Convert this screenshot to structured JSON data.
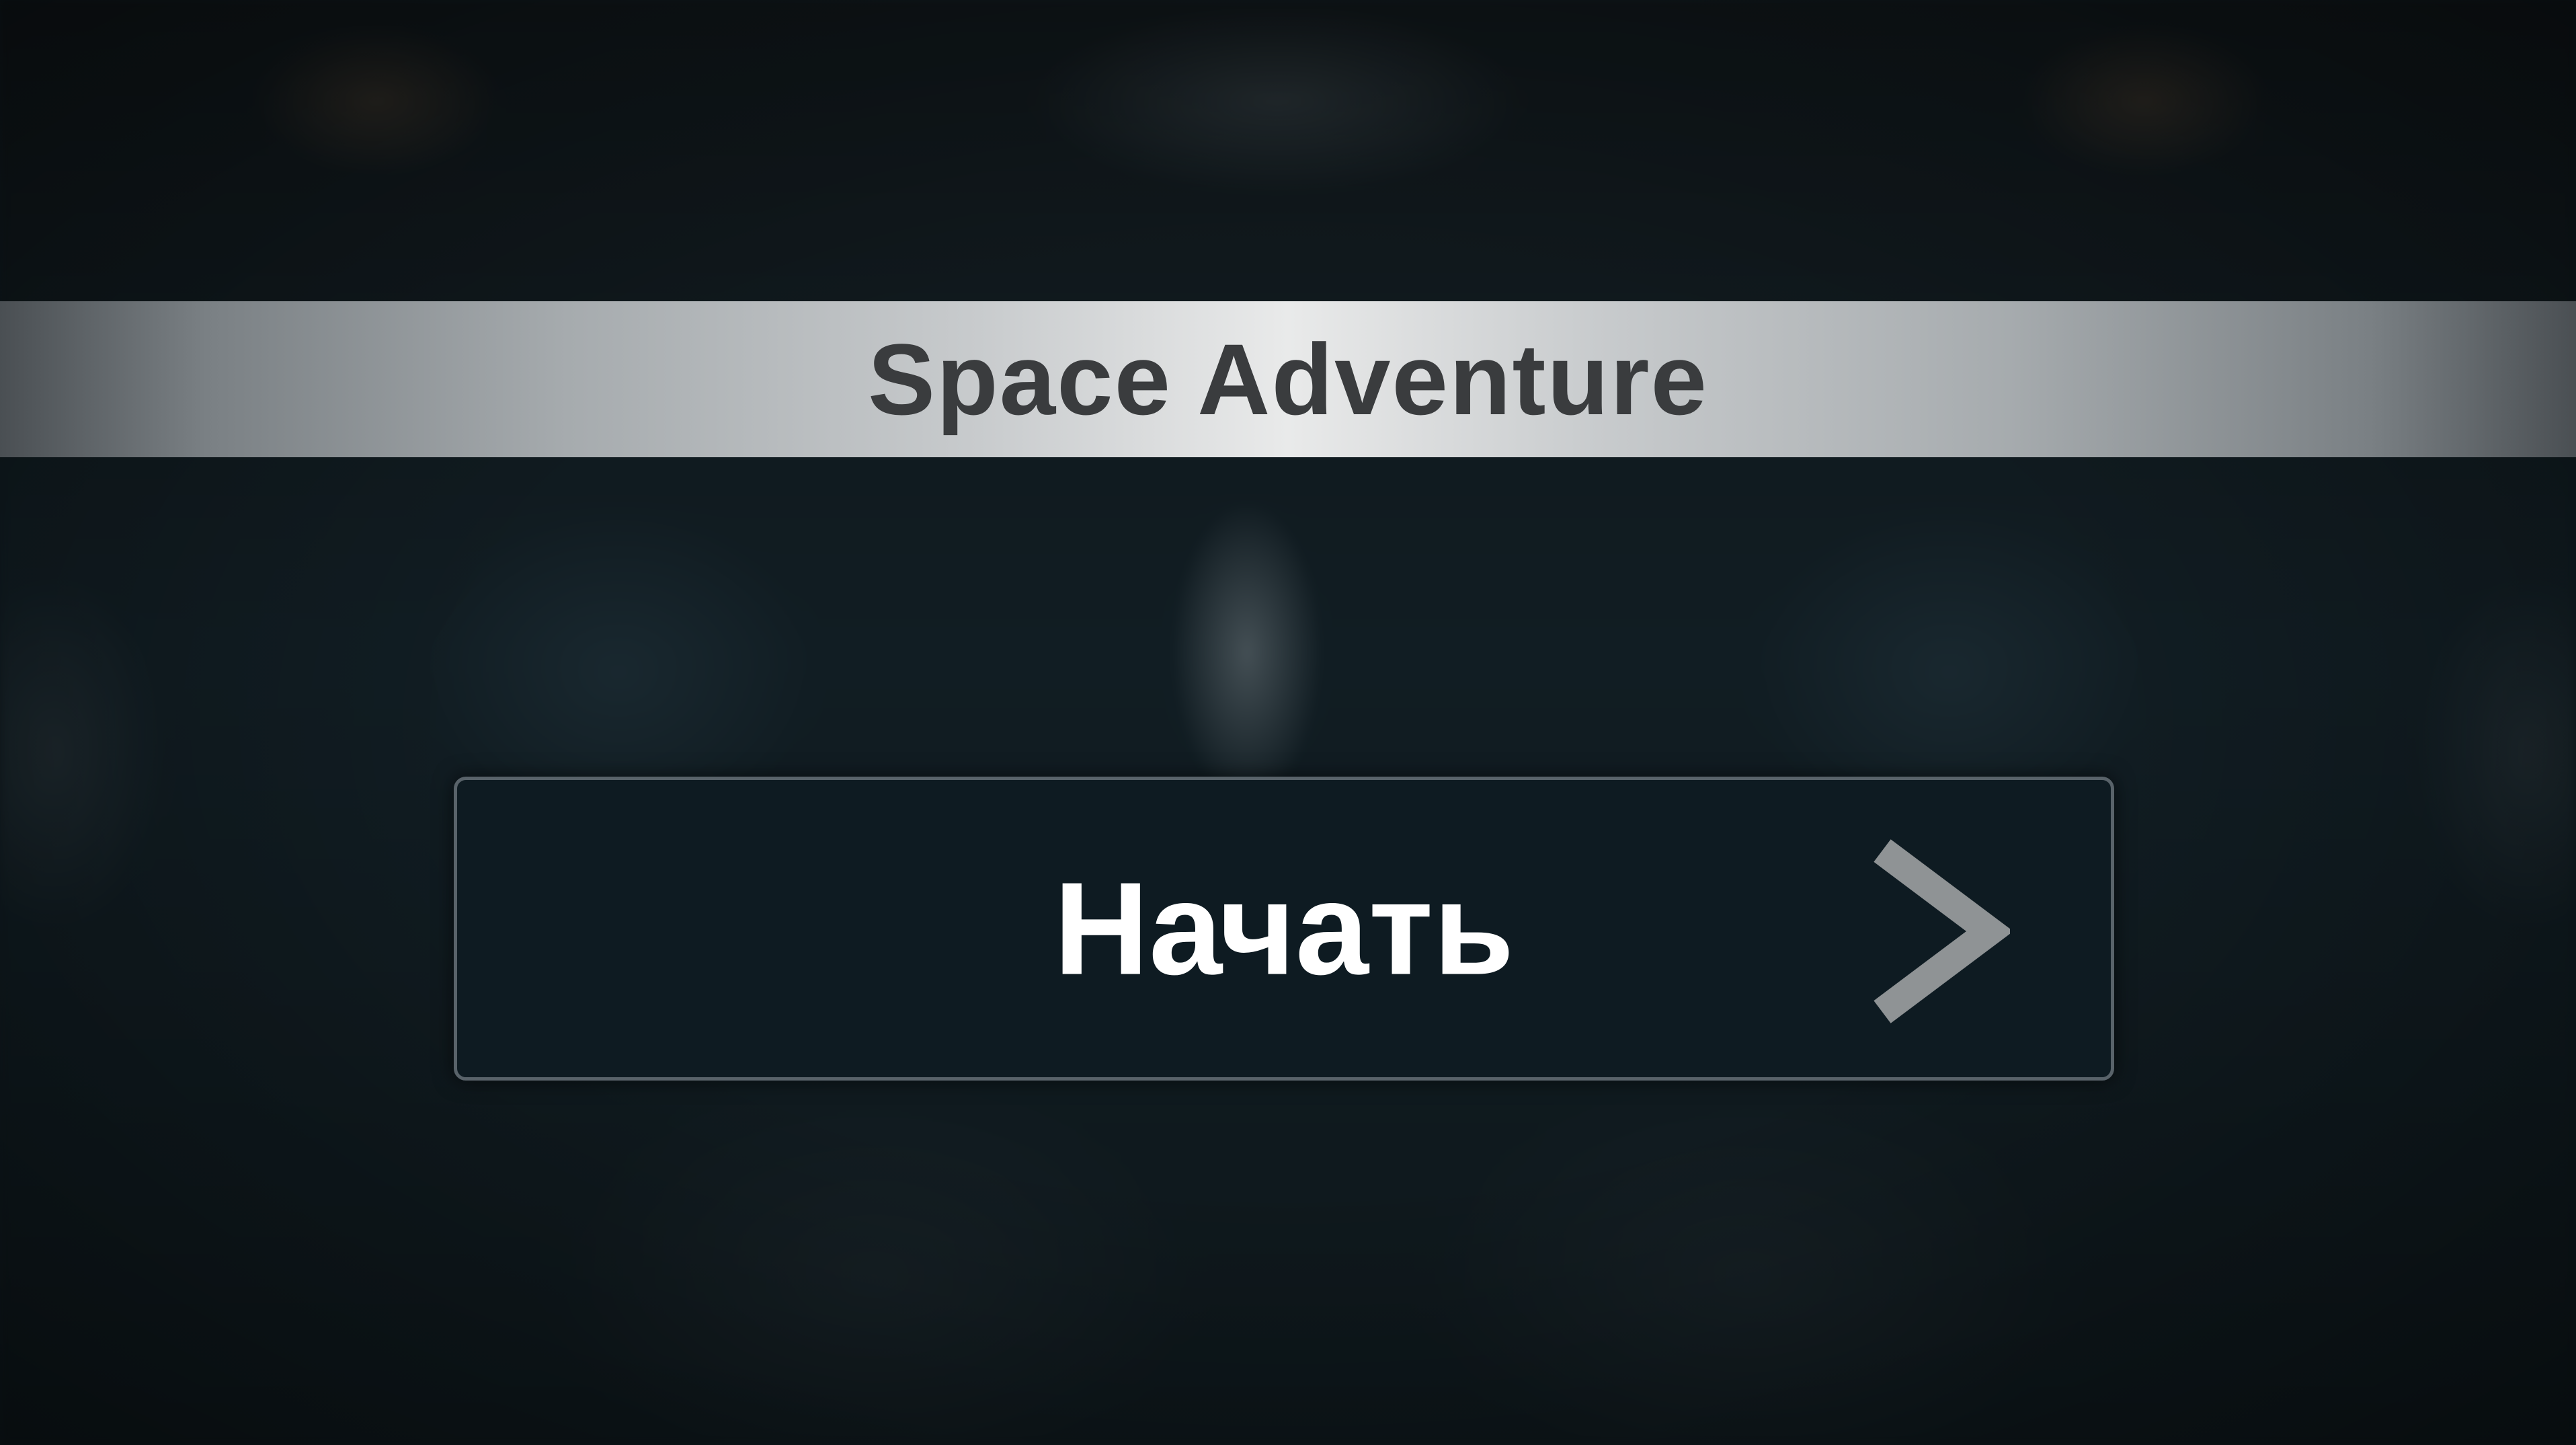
{
  "title": "Space Adventure",
  "start_button": {
    "label": "Начать",
    "icon": "chevron-right-icon"
  },
  "colors": {
    "banner_center": "#e9eaea",
    "banner_edge": "#4a4f53",
    "title_text": "#3a3c3e",
    "button_bg": "#0e1b22",
    "button_border": "#59636a",
    "button_text": "#ffffff",
    "chevron": "#8f9395"
  }
}
